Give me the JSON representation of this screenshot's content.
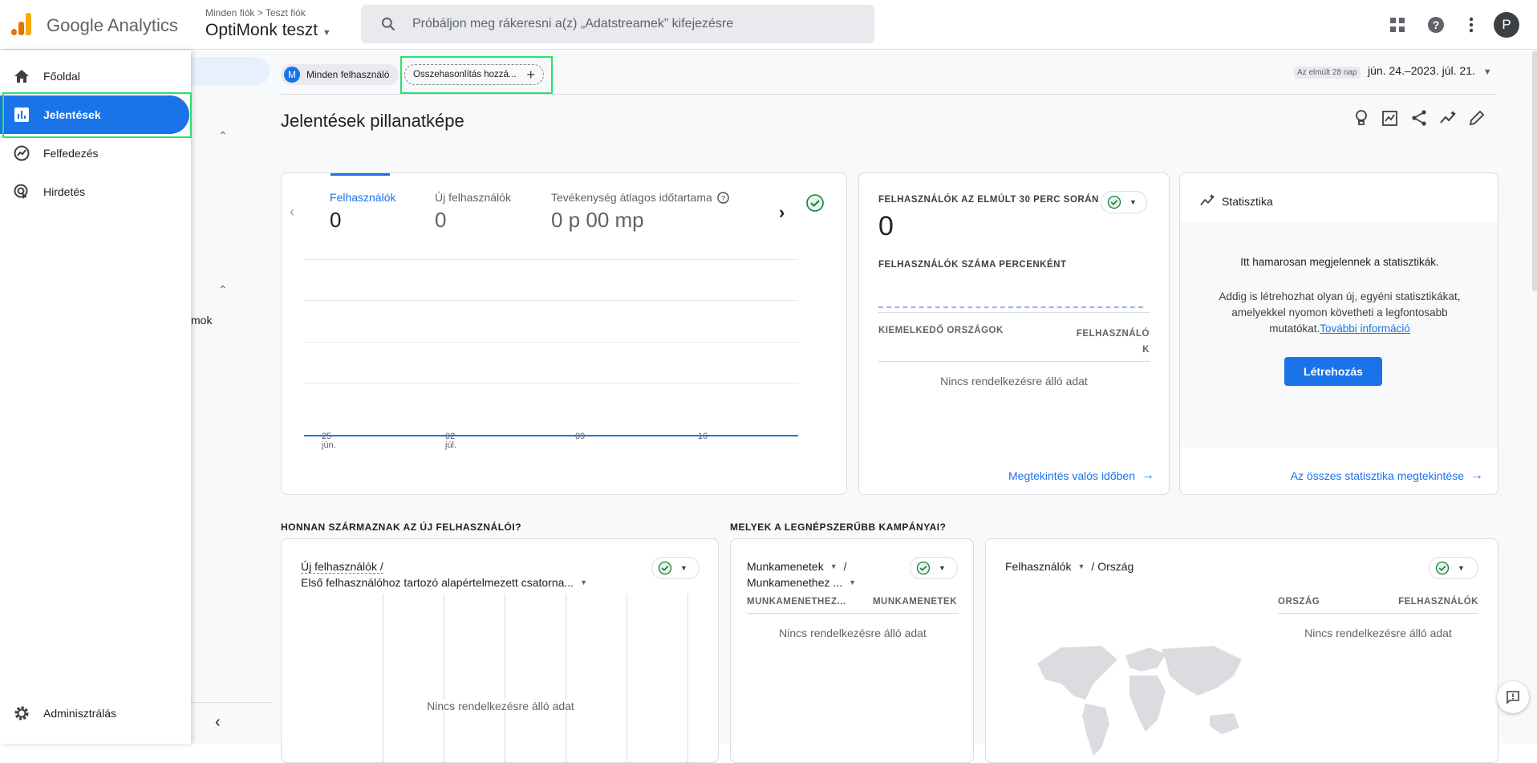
{
  "app": {
    "name": "Google Analytics"
  },
  "header": {
    "breadcrumb": [
      "Minden fiók",
      "Teszt fiók"
    ],
    "property": "OptiMonk teszt",
    "search_placeholder": "Próbáljon meg rákeresni a(z) „Adatstreamek” kifejezésre",
    "avatar_letter": "P"
  },
  "sidebar": {
    "items": [
      {
        "label": "Főoldal",
        "icon": "home-icon"
      },
      {
        "label": "Jelentések",
        "icon": "bar-chart-icon",
        "active": true
      },
      {
        "label": "Felfedezés",
        "icon": "explore-icon"
      },
      {
        "label": "Hirdetés",
        "icon": "advertising-icon"
      }
    ],
    "admin": "Adminisztrálás",
    "partial_text": "mok"
  },
  "toolbar": {
    "segment_letter": "M",
    "segment": "Minden felhasználó",
    "compare": "Összehasonlítás hozzá...",
    "date_prefix": "Az elmúlt 28 nap",
    "date_range": "jún. 24.–2023. júl. 21."
  },
  "page": {
    "title": "Jelentések pillanatképe"
  },
  "overview": {
    "metrics": [
      {
        "label": "Felhasználók",
        "value": "0"
      },
      {
        "label": "Új felhasználók",
        "value": "0"
      },
      {
        "label": "Tevékenység átlagos időtartama",
        "value": "0 p 00 mp"
      }
    ],
    "x_ticks": [
      {
        "day": "25",
        "month": "jún."
      },
      {
        "day": "02",
        "month": "júl."
      },
      {
        "day": "09",
        "month": ""
      },
      {
        "day": "16",
        "month": ""
      }
    ]
  },
  "chart_data": {
    "type": "line",
    "categories": [
      "25 jún.",
      "02 júl.",
      "09",
      "16"
    ],
    "series": [
      {
        "name": "Felhasználók",
        "values": [
          0,
          0,
          0,
          0
        ]
      }
    ],
    "title": "",
    "xlabel": "",
    "ylabel": ""
  },
  "realtime": {
    "title": "FELHASZNÁLÓK AZ ELMÚLT 30 PERC SORÁN",
    "value": "0",
    "per_minute": "FELHASZNÁLÓK SZÁMA PERCENKÉNT",
    "col1": "KIEMELKEDŐ ORSZÁGOK",
    "col2a": "FELHASZNÁLÓ",
    "col2b": "K",
    "empty": "Nincs rendelkezésre álló adat",
    "link": "Megtekintés valós időben"
  },
  "insights": {
    "title": "Statisztika",
    "heading": "Itt hamarosan megjelennek a statisztikák.",
    "body": "Addig is létrehozhat olyan új, egyéni statisztikákat, amelyekkel nyomon követheti a legfontosabb mutatókat.",
    "more": "További információ",
    "button": "Létrehozás",
    "link": "Az összes statisztika megtekintése"
  },
  "sections": {
    "new_users_q": "HONNAN SZÁRMAZNAK AZ ÚJ FELHASZNÁLÓI?",
    "campaigns_q": "MELYEK A LEGNÉPSZERŰBB KAMPÁNYAI?"
  },
  "channel_card": {
    "metric": "Új felhasználók /",
    "dimension": "Első felhasználóhoz tartozó alapértelmezett csatorna...",
    "empty": "Nincs rendelkezésre álló adat"
  },
  "sessions_card": {
    "metric": "Munkamenetek",
    "slash": "/",
    "dimension": "Munkamenethez ...",
    "col1": "MUNKAMENETHEZ...",
    "col2": "MUNKAMENETEK",
    "empty": "Nincs rendelkezésre álló adat"
  },
  "country_card": {
    "metric": "Felhasználók",
    "dimension": "/ Ország",
    "col1": "ORSZÁG",
    "col2": "FELHASZNÁLÓK",
    "empty": "Nincs rendelkezésre álló adat"
  },
  "colors": {
    "accent": "#1a73e8",
    "highlight": "#27e36a",
    "check": "#188038"
  }
}
